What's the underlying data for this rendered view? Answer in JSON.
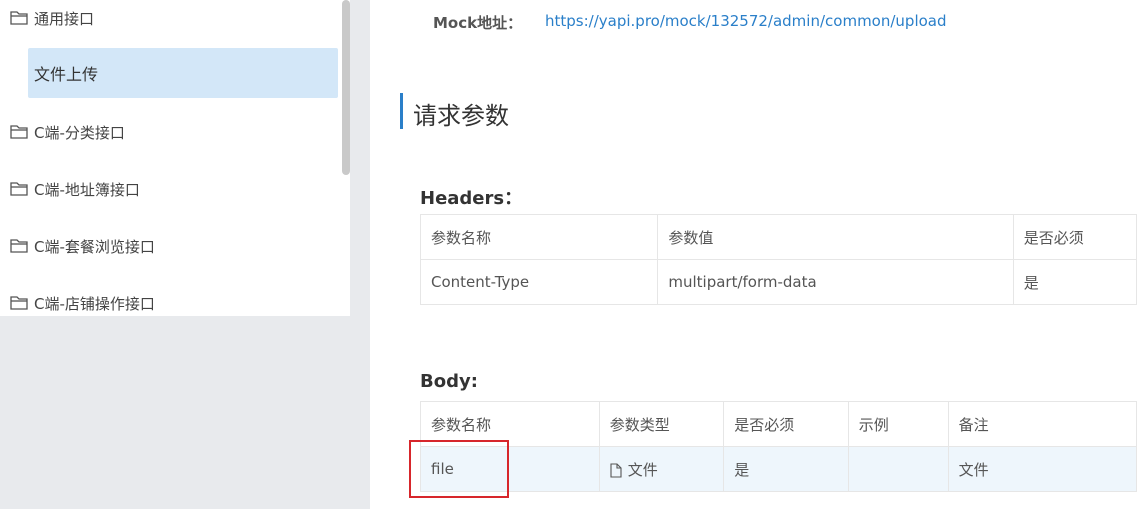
{
  "sidebar": {
    "items": [
      {
        "label": "通用接口",
        "icon": "folder-icon"
      },
      {
        "label": "C端-分类接口",
        "icon": "folder-icon"
      },
      {
        "label": "C端-地址簿接口",
        "icon": "folder-icon"
      },
      {
        "label": "C端-套餐浏览接口",
        "icon": "folder-icon"
      },
      {
        "label": "C端-店铺操作接口",
        "icon": "folder-icon"
      }
    ],
    "selected_sub": "文件上传"
  },
  "main": {
    "mock_label": "Mock地址：",
    "mock_url": "https://yapi.pro/mock/132572/admin/common/upload",
    "section_title": "请求参数",
    "headers": {
      "title": "Headers：",
      "columns": [
        "参数名称",
        "参数值",
        "是否必须"
      ],
      "rows": [
        [
          "Content-Type",
          "multipart/form-data",
          "是"
        ]
      ]
    },
    "body": {
      "title": "Body:",
      "columns": [
        "参数名称",
        "参数类型",
        "是否必须",
        "示例",
        "备注"
      ],
      "rows": [
        [
          "file",
          "文件",
          "是",
          "",
          "文件"
        ]
      ]
    }
  },
  "colors": {
    "accent": "#2a7fc9",
    "highlight": "#d3e7f8",
    "red_box": "#d7262b"
  }
}
